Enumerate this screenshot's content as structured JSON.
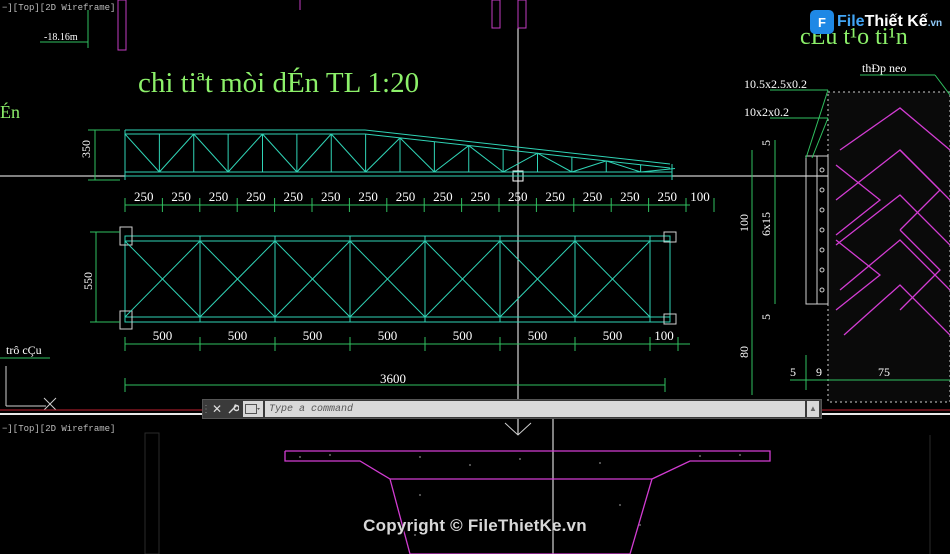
{
  "viewport_top": {
    "label": "−][Top][2D Wireframe]",
    "elevation": "-18.16m",
    "drawing_title": "chi tiªt mòi dÉn TL 1:20",
    "partial_title_left": "Én",
    "partial_title_right": "cÊu t¹o ti¹n",
    "anchor_label": "thĐp neo",
    "plate_label_1": "10.5x2.5x0.2",
    "plate_label_2": "10x2x0.2",
    "ucs_label": "trô cÇu",
    "top_height_dim": "350",
    "top_spacings": [
      "250",
      "250",
      "250",
      "250",
      "250",
      "250",
      "250",
      "250",
      "250",
      "250",
      "250",
      "250",
      "250",
      "250",
      "250",
      "100"
    ],
    "plan_height_dim": "550",
    "plan_spacings": [
      "500",
      "500",
      "500",
      "500",
      "500",
      "500",
      "500",
      "100"
    ],
    "overall_dim": "3600",
    "side_dims": [
      "5",
      "100",
      "6x15",
      "5",
      "80",
      "5",
      "9",
      "75"
    ]
  },
  "viewport_bottom": {
    "label": "−][Top][2D Wireframe]"
  },
  "command_line": {
    "placeholder": "Type a command",
    "close_icon": "close-icon",
    "customize_icon": "wrench-icon",
    "prompt_icon": "command-prompt-icon"
  },
  "watermark": "Copyright © FileThietKe.vn",
  "logo": {
    "mark": "F",
    "text_a": "File",
    "text_b": "Thiết Kế",
    "text_c": ".vn"
  },
  "colors": {
    "background": "#000000",
    "truss": "#30d4b6",
    "title": "#8cf06a",
    "dimension": "#30c060",
    "dim_text": "#ffffff",
    "anchor": "#d23cd2",
    "divider": "#e8e8e8"
  }
}
